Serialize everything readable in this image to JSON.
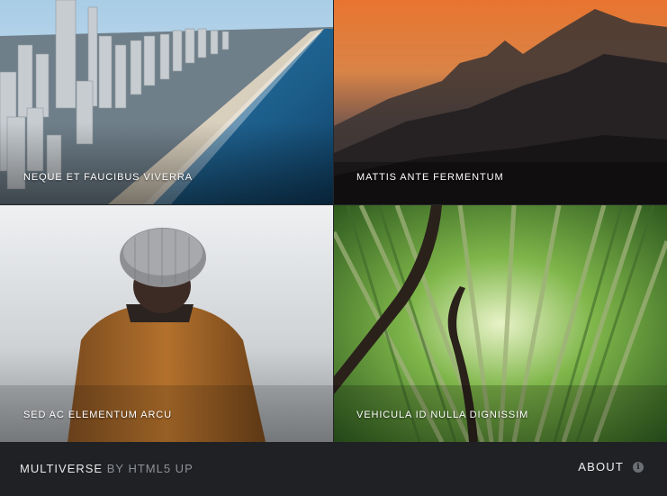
{
  "tiles": [
    {
      "caption": "NEQUE ET FAUCIBUS VIVERRA"
    },
    {
      "caption": "MATTIS ANTE FERMENTUM"
    },
    {
      "caption": "SED AC ELEMENTUM ARCU"
    },
    {
      "caption": "VEHICULA ID NULLA DIGNISSIM"
    }
  ],
  "footer": {
    "brand_name": "MULTIVERSE",
    "brand_by": "BY HTML5 UP",
    "about_label": "ABOUT",
    "about_icon": "info-icon"
  }
}
